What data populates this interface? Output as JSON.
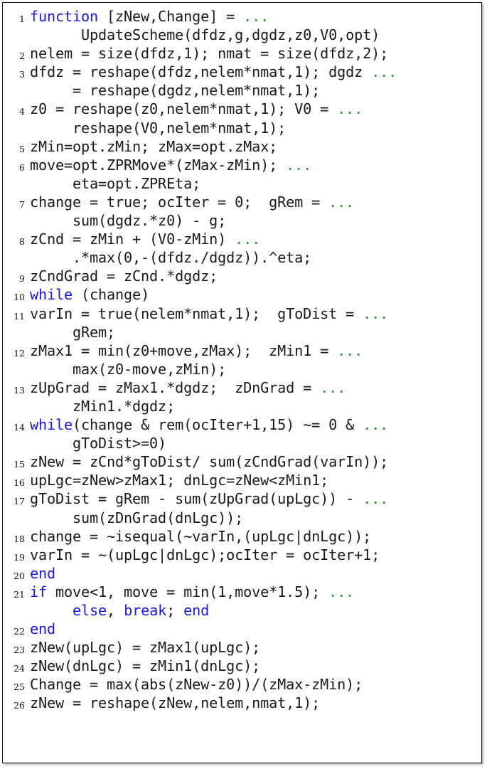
{
  "listing": {
    "language": "MATLAB",
    "function_name": "UpdateScheme",
    "colors": {
      "keyword": "#1a1ad6",
      "continuation": "#1f991f",
      "text": "#1a1a1a",
      "background": "#ffffff",
      "border": "#1a1a1a"
    },
    "first_line_number": 1,
    "last_line_number": 26,
    "lines": [
      {
        "number": "1",
        "rows": [
          [
            {
              "t": "function",
              "c": "kw"
            },
            {
              "t": " [zNew,Change] = ",
              "c": "plain"
            },
            {
              "t": "...",
              "c": "cont"
            }
          ],
          [
            {
              "t": "      UpdateScheme(dfdz,g,dgdz,z0,V0,opt)",
              "c": "plain"
            }
          ]
        ]
      },
      {
        "number": "2",
        "rows": [
          [
            {
              "t": "nelem = size(dfdz,1); nmat = size(dfdz,2);",
              "c": "plain"
            }
          ]
        ]
      },
      {
        "number": "3",
        "rows": [
          [
            {
              "t": "dfdz = reshape(dfdz,nelem*nmat,1); dgdz ",
              "c": "plain"
            },
            {
              "t": "...",
              "c": "cont"
            }
          ],
          [
            {
              "t": "     = reshape(dgdz,nelem*nmat,1);",
              "c": "plain"
            }
          ]
        ]
      },
      {
        "number": "4",
        "rows": [
          [
            {
              "t": "z0 = reshape(z0,nelem*nmat,1); V0 = ",
              "c": "plain"
            },
            {
              "t": "...",
              "c": "cont"
            }
          ],
          [
            {
              "t": "     reshape(V0,nelem*nmat,1);",
              "c": "plain"
            }
          ]
        ]
      },
      {
        "number": "5",
        "rows": [
          [
            {
              "t": "zMin=opt.zMin; zMax=opt.zMax;",
              "c": "plain"
            }
          ]
        ]
      },
      {
        "number": "6",
        "rows": [
          [
            {
              "t": "move=opt.ZPRMove*(zMax-zMin); ",
              "c": "plain"
            },
            {
              "t": "...",
              "c": "cont"
            }
          ],
          [
            {
              "t": "     eta=opt.ZPREta;",
              "c": "plain"
            }
          ]
        ]
      },
      {
        "number": "7",
        "rows": [
          [
            {
              "t": "change = true; ocIter = 0;  gRem = ",
              "c": "plain"
            },
            {
              "t": "...",
              "c": "cont"
            }
          ],
          [
            {
              "t": "     sum(dgdz.*z0) - g;",
              "c": "plain"
            }
          ]
        ]
      },
      {
        "number": "8",
        "rows": [
          [
            {
              "t": "zCnd = zMin + (V0-zMin) ",
              "c": "plain"
            },
            {
              "t": "...",
              "c": "cont"
            }
          ],
          [
            {
              "t": "     .*max(0,-(dfdz./dgdz)).^eta;",
              "c": "plain"
            }
          ]
        ]
      },
      {
        "number": "9",
        "rows": [
          [
            {
              "t": "zCndGrad = zCnd.*dgdz;",
              "c": "plain"
            }
          ]
        ]
      },
      {
        "number": "10",
        "rows": [
          [
            {
              "t": "while",
              "c": "kw"
            },
            {
              "t": " (change)",
              "c": "plain"
            }
          ]
        ]
      },
      {
        "number": "11",
        "rows": [
          [
            {
              "t": "varIn = true(nelem*nmat,1);  gToDist = ",
              "c": "plain"
            },
            {
              "t": "...",
              "c": "cont"
            }
          ],
          [
            {
              "t": "     gRem;",
              "c": "plain"
            }
          ]
        ]
      },
      {
        "number": "12",
        "rows": [
          [
            {
              "t": "zMax1 = min(z0+move,zMax);  zMin1 = ",
              "c": "plain"
            },
            {
              "t": "...",
              "c": "cont"
            }
          ],
          [
            {
              "t": "     max(z0-move,zMin);",
              "c": "plain"
            }
          ]
        ]
      },
      {
        "number": "13",
        "rows": [
          [
            {
              "t": "zUpGrad = zMax1.*dgdz;  zDnGrad = ",
              "c": "plain"
            },
            {
              "t": "...",
              "c": "cont"
            }
          ],
          [
            {
              "t": "     zMin1.*dgdz;",
              "c": "plain"
            }
          ]
        ]
      },
      {
        "number": "14",
        "rows": [
          [
            {
              "t": "while",
              "c": "kw"
            },
            {
              "t": "(change & rem(ocIter+1,15) ∼= 0 & ",
              "c": "plain"
            },
            {
              "t": "...",
              "c": "cont"
            }
          ],
          [
            {
              "t": "     gToDist>=0)",
              "c": "plain"
            }
          ]
        ]
      },
      {
        "number": "15",
        "rows": [
          [
            {
              "t": "zNew = zCnd*gToDist/ sum(zCndGrad(varIn));",
              "c": "plain"
            }
          ]
        ]
      },
      {
        "number": "16",
        "rows": [
          [
            {
              "t": "upLgc=zNew>zMax1; dnLgc=zNew<zMin1;",
              "c": "plain"
            }
          ]
        ]
      },
      {
        "number": "17",
        "rows": [
          [
            {
              "t": "gToDist = gRem - sum(zUpGrad(upLgc)) - ",
              "c": "plain"
            },
            {
              "t": "...",
              "c": "cont"
            }
          ],
          [
            {
              "t": "     sum(zDnGrad(dnLgc));",
              "c": "plain"
            }
          ]
        ]
      },
      {
        "number": "18",
        "rows": [
          [
            {
              "t": "change = ∼isequal(∼varIn,(upLgc|dnLgc));",
              "c": "plain"
            }
          ]
        ]
      },
      {
        "number": "19",
        "rows": [
          [
            {
              "t": "varIn = ∼(upLgc|dnLgc);ocIter = ocIter+1;",
              "c": "plain"
            }
          ]
        ]
      },
      {
        "number": "20",
        "rows": [
          [
            {
              "t": "end",
              "c": "kw"
            }
          ]
        ]
      },
      {
        "number": "21",
        "rows": [
          [
            {
              "t": "if",
              "c": "kw"
            },
            {
              "t": " move<1, move = min(1,move*1.5); ",
              "c": "plain"
            },
            {
              "t": "...",
              "c": "cont"
            }
          ],
          [
            {
              "t": "     ",
              "c": "plain"
            },
            {
              "t": "else",
              "c": "kw"
            },
            {
              "t": ", ",
              "c": "plain"
            },
            {
              "t": "break",
              "c": "kw"
            },
            {
              "t": "; ",
              "c": "plain"
            },
            {
              "t": "end",
              "c": "kw"
            }
          ]
        ]
      },
      {
        "number": "22",
        "rows": [
          [
            {
              "t": "end",
              "c": "kw"
            }
          ]
        ]
      },
      {
        "number": "23",
        "rows": [
          [
            {
              "t": "zNew(upLgc) = zMax1(upLgc);",
              "c": "plain"
            }
          ]
        ]
      },
      {
        "number": "24",
        "rows": [
          [
            {
              "t": "zNew(dnLgc) = zMin1(dnLgc);",
              "c": "plain"
            }
          ]
        ]
      },
      {
        "number": "25",
        "rows": [
          [
            {
              "t": "Change = max(abs(zNew-z0))/(zMax-zMin);",
              "c": "plain"
            }
          ]
        ]
      },
      {
        "number": "26",
        "rows": [
          [
            {
              "t": "zNew = reshape(zNew,nelem,nmat,1);",
              "c": "plain"
            }
          ]
        ]
      }
    ]
  }
}
